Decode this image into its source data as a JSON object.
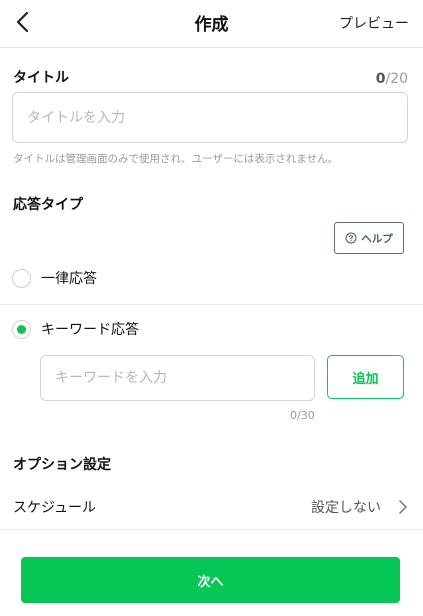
{
  "header": {
    "title": "作成",
    "preview_label": "プレビュー"
  },
  "title_section": {
    "label": "タイトル",
    "count_current": "0",
    "count_max": "/20",
    "placeholder": "タイトルを入力",
    "value": "",
    "hint": "タイトルは管理画面のみで使用され、ユーザーには表示されません。"
  },
  "response_type": {
    "label": "応答タイプ",
    "help_label": "ヘルプ",
    "options": [
      {
        "label": "一律応答",
        "checked": false
      },
      {
        "label": "キーワード応答",
        "checked": true
      }
    ],
    "keyword_placeholder": "キーワードを入力",
    "keyword_value": "",
    "add_label": "追加",
    "keyword_counter": "0/30"
  },
  "options_section": {
    "label": "オプション設定",
    "schedule_label": "スケジュール",
    "schedule_value": "設定しない"
  },
  "footer": {
    "next_label": "次へ"
  },
  "colors": {
    "accent": "#06c755",
    "help_border": "#5a6b86"
  },
  "icons": {
    "back": "chevron-left-icon",
    "help": "question-circle-icon",
    "schedule_chevron": "chevron-right-icon"
  }
}
